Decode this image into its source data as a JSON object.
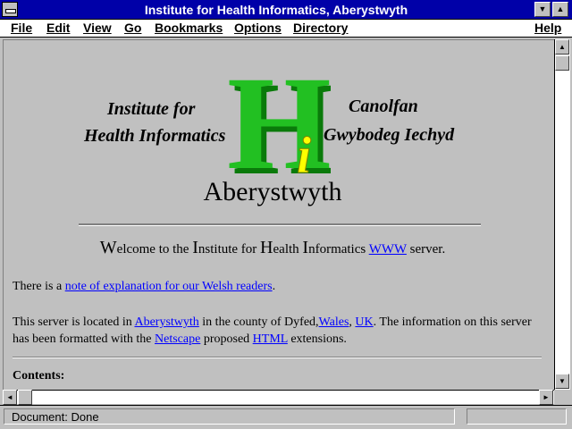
{
  "window": {
    "title": "Institute for Health Informatics, Aberystwyth",
    "minimize_glyph": "▼",
    "maximize_glyph": "▲"
  },
  "menu": [
    {
      "label": "File"
    },
    {
      "label": "Edit"
    },
    {
      "label": "View"
    },
    {
      "label": "Go"
    },
    {
      "label": "Bookmarks"
    },
    {
      "label": "Options"
    },
    {
      "label": "Directory"
    },
    {
      "label": "Help"
    }
  ],
  "logo": {
    "left_line1": "Institute for",
    "left_line2": "Health Informatics",
    "right_line1": "Canolfan",
    "right_line2": "Gwybodeg Iechyd",
    "big_letter": "H",
    "small_letter": "i",
    "city": "Aberystwyth",
    "colors": {
      "h_green": "#22c022",
      "h_dark": "#0a7a0a",
      "i_yellow": "#ffff00"
    }
  },
  "welcome": {
    "w_cap": "W",
    "w_rest": "elcome to the ",
    "i_cap": "I",
    "i_rest": "nstitute for ",
    "h_cap": "H",
    "h_rest": "ealth ",
    "inf_cap": "I",
    "inf_rest": "nformatics ",
    "link": "WWW",
    "suffix": " server."
  },
  "paragraph1": {
    "prefix": "There is a ",
    "link": "note of explanation for our Welsh readers",
    "suffix": "."
  },
  "paragraph2": {
    "t1": "This server is located in ",
    "link_aber": "Aberystwyth",
    "t2": " in the county of Dyfed,",
    "link_wales": "Wales",
    "t3": ", ",
    "link_uk": "UK",
    "t4": ". The information on this server has been formatted with the ",
    "link_netscape": "Netscape",
    "t5": " proposed ",
    "link_html": "HTML",
    "t6": " extensions."
  },
  "contents_heading": "Contents:",
  "status": {
    "text": "Document: Done"
  },
  "colors": {
    "titlebar": "#0000a8",
    "link": "#0000ff",
    "background": "#c0c0c0"
  }
}
